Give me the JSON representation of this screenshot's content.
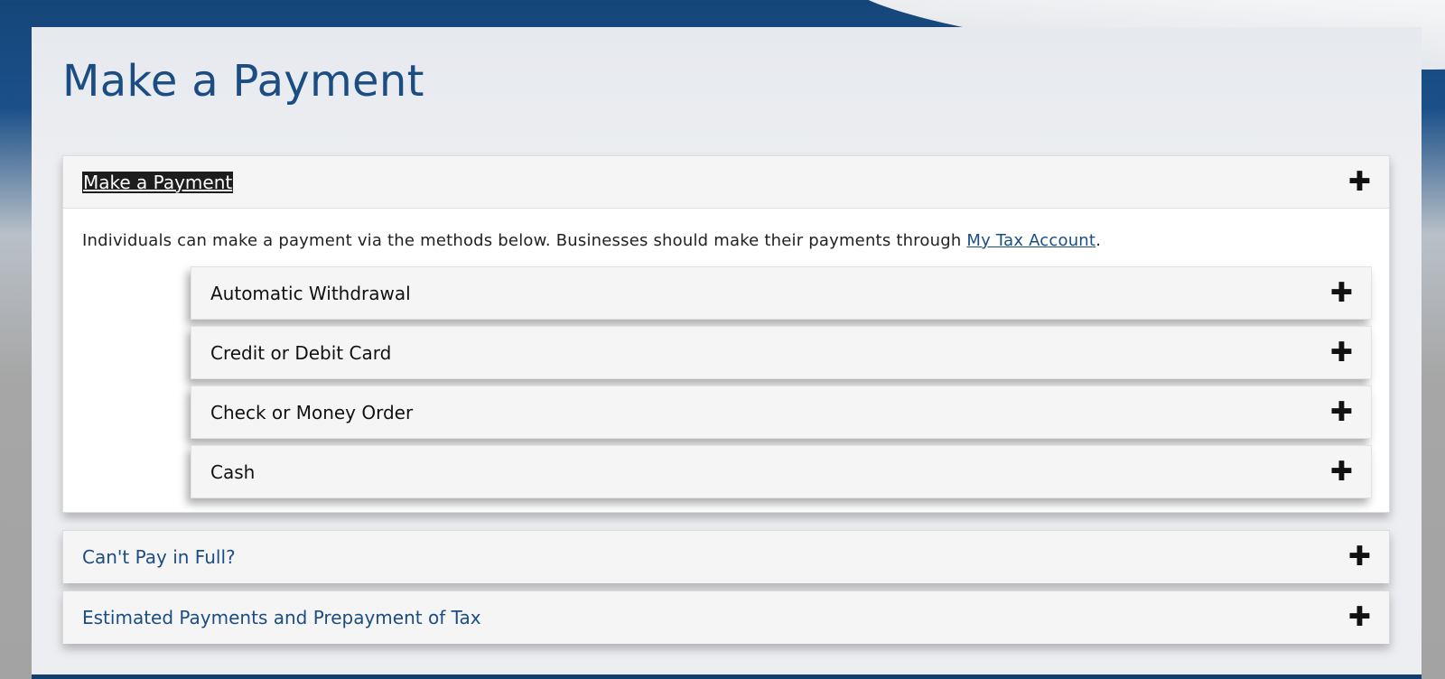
{
  "page": {
    "title": "Make a Payment"
  },
  "main_panel": {
    "heading": "Make a Payment",
    "toggle_icon": "plus-icon",
    "intro_text": "Individuals can make a payment via the methods below. Businesses should make their payments through ",
    "intro_link": "My Tax Account",
    "intro_end": ".",
    "methods": [
      {
        "label": "Automatic Withdrawal"
      },
      {
        "label": "Credit or Debit Card"
      },
      {
        "label": "Check or Money Order"
      },
      {
        "label": "Cash"
      }
    ]
  },
  "panels": [
    {
      "label": "Can't Pay in Full?"
    },
    {
      "label": "Estimated Payments and Prepayment of Tax"
    }
  ],
  "colors": {
    "brand_blue": "#1b4d83",
    "header_band": "#15467a",
    "panel_header": "#f5f5f5",
    "footer_bar": "#123f6e"
  }
}
